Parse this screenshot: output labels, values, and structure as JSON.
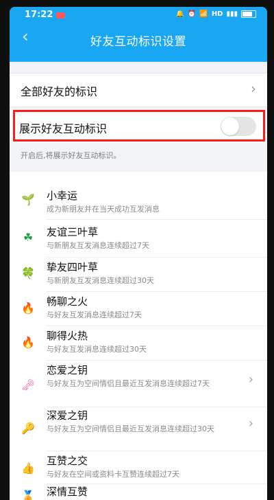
{
  "status_bar": {
    "time": "17:22",
    "network": "HD",
    "icons": [
      "bell-icon",
      "alarm-icon",
      "wifi-icon",
      "signal-icon",
      "battery-icon"
    ]
  },
  "header": {
    "title": "好友互动标识设置",
    "back_icon": "chevron-left-icon",
    "background": "#19a7f4"
  },
  "all_friends": {
    "label": "全部好友的标识"
  },
  "toggle_row": {
    "label": "展示好友互动标识",
    "enabled": false,
    "hint": "开启后,将展示好友互动标识。"
  },
  "items": [
    {
      "name": "小幸运",
      "desc": "成为新朋友并在当天成功互发消息",
      "icon": "sprout-icon"
    },
    {
      "name": "友谊三叶草",
      "desc": "与新朋友互发消息连续超过7天",
      "icon": "clover-three-icon"
    },
    {
      "name": "挚友四叶草",
      "desc": "与新朋友互发消息连续超过30天",
      "icon": "clover-four-icon"
    },
    {
      "name": "畅聊之火",
      "desc": "与好友互发消息连续超过7天",
      "icon": "flame-icon"
    },
    {
      "name": "聊得火热",
      "desc": "与好友互发消息连续超过30天",
      "icon": "big-flame-icon"
    },
    {
      "name": "恋爱之钥",
      "desc": "与好友互为空间情侣且最近互发消息连续超过7天",
      "icon": "pink-key-icon"
    },
    {
      "name": "深爱之钥",
      "desc": "与好友互为空间情侣且最近互发消息连续超过30天",
      "icon": "pink-key-big-icon"
    },
    {
      "name": "互赞之交",
      "desc": "与好友在空间或资料卡互赞连续超过7天",
      "icon": "thumbs-up-icon"
    },
    {
      "name": "深情互赞",
      "desc": "",
      "icon": "medal-icon"
    }
  ]
}
